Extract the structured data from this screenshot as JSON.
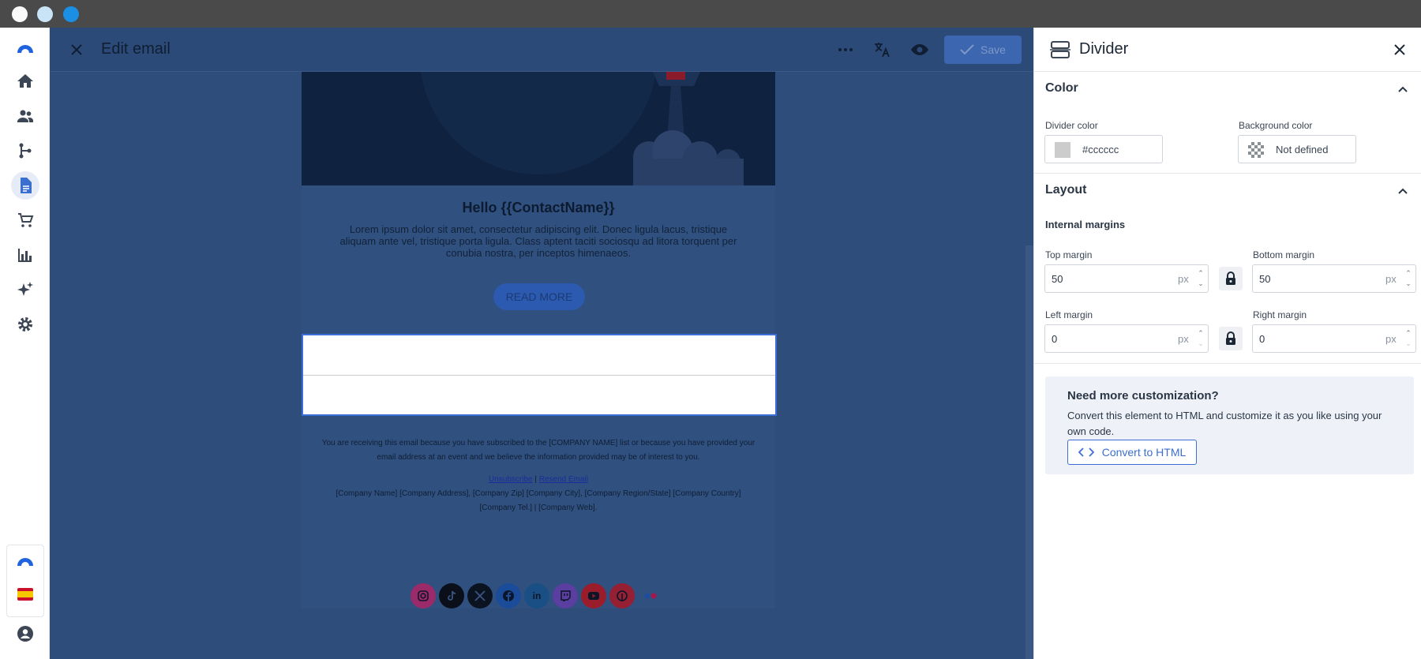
{
  "window_controls": [
    "close",
    "minimize",
    "maximize"
  ],
  "colors": {
    "accent": "#3c6fd1",
    "overlay": "#2f4d7b",
    "divider": "#cccccc"
  },
  "nav": {
    "items": [
      {
        "icon": "logo-icon"
      },
      {
        "icon": "home-icon"
      },
      {
        "icon": "contacts-icon"
      },
      {
        "icon": "automation-icon"
      },
      {
        "icon": "document-icon",
        "active": true
      },
      {
        "icon": "cart-icon"
      },
      {
        "icon": "chart-icon"
      },
      {
        "icon": "sparkle-icon"
      },
      {
        "icon": "settings-icon"
      }
    ],
    "bottom": [
      {
        "icon": "logo-icon"
      },
      {
        "icon": "spain-flag-icon"
      },
      {
        "icon": "account-icon"
      }
    ]
  },
  "editor": {
    "title": "Edit email",
    "save_label": "Save",
    "email": {
      "greeting": "Hello {{ContactName}}",
      "lorem": "Lorem ipsum dolor sit amet, consectetur adipiscing elit. Donec ligula lacus, tristique aliquam ante vel, tristique porta ligula. Class aptent taciti sociosqu ad litora torquent per conubia nostra, per inceptos himenaeos.",
      "read_more": "READ MORE",
      "footer_text": "You are receiving this email because you have subscribed to the [COMPANY NAME] list or because you have provided your email address at an event and we believe the information provided may be of interest to you.",
      "unsubscribe": "Unsubscribe",
      "separator": "|",
      "resend": "Resend Email",
      "address": "[Company Name] [Company Address], [Company Zip] [Company City], [Company Region/State] [Company Country] [Company Tel.] | [Company Web].",
      "social": [
        "instagram-icon",
        "tiktok-icon",
        "x-icon",
        "facebook-icon",
        "linkedin-icon",
        "twitch-icon",
        "youtube-icon",
        "pinterest-icon",
        "flickr-icon"
      ]
    }
  },
  "panel": {
    "title": "Divider",
    "color_section": {
      "title": "Color",
      "divider_color_label": "Divider color",
      "divider_color_value": "#cccccc",
      "background_color_label": "Background color",
      "background_color_value": "Not defined"
    },
    "layout_section": {
      "title": "Layout",
      "internal_margins": "Internal margins",
      "top_label": "Top margin",
      "top_value": "50",
      "bottom_label": "Bottom margin",
      "bottom_value": "50",
      "left_label": "Left margin",
      "left_value": "0",
      "right_label": "Right margin",
      "right_value": "0",
      "unit": "px"
    },
    "custom": {
      "title": "Need more customization?",
      "text": "Convert this element to HTML and customize it as you like using your own code.",
      "button": "Convert to HTML"
    }
  }
}
